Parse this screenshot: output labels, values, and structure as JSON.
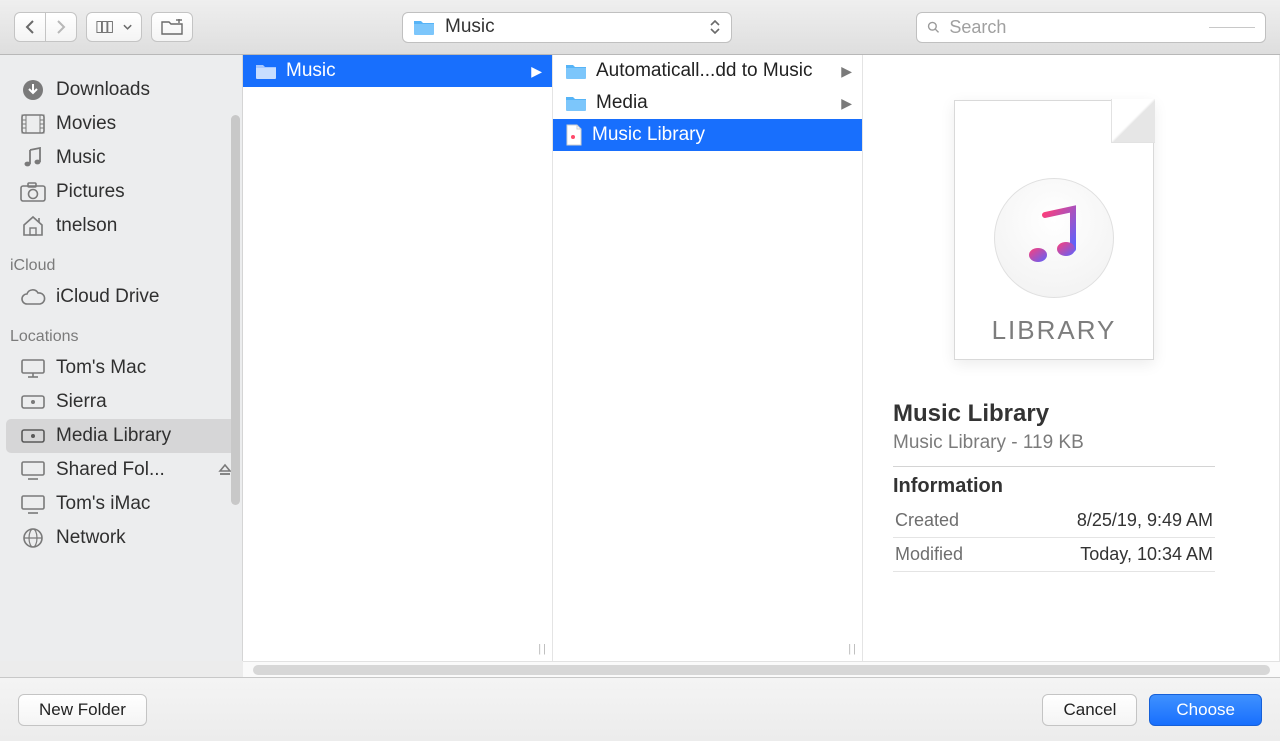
{
  "toolbar": {
    "path_label": "Music",
    "search_placeholder": "Search"
  },
  "sidebar": {
    "fav0": "Downloads",
    "fav1": "Movies",
    "fav2": "Music",
    "fav3": "Pictures",
    "fav4": "tnelson",
    "h_icloud": "iCloud",
    "icloud0": "iCloud Drive",
    "h_loc": "Locations",
    "loc0": "Tom's Mac",
    "loc1": "Sierra",
    "loc2": "Media Library",
    "loc3": "Shared Fol...",
    "loc4": "Tom's iMac",
    "loc5": "Network"
  },
  "col1": {
    "item0": "Music"
  },
  "col2": {
    "item0": "Automaticall...dd to Music",
    "item1": "Media",
    "item2": "Music Library"
  },
  "preview": {
    "icon_text": "LIBRARY",
    "title": "Music Library",
    "subtitle": "Music Library - 119 KB",
    "info_h": "Information",
    "created_k": "Created",
    "created_v": "8/25/19, 9:49 AM",
    "modified_k": "Modified",
    "modified_v": "Today, 10:34 AM"
  },
  "footer": {
    "new_folder": "New Folder",
    "cancel": "Cancel",
    "choose": "Choose"
  }
}
